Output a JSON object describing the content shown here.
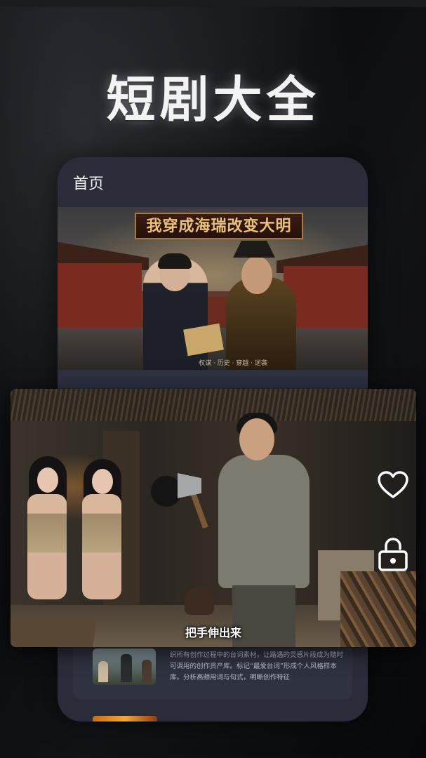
{
  "headline": "短剧大全",
  "phone": {
    "title": "首页",
    "poster": {
      "banner": "我穿成海瑞改变大明",
      "credits": "权谋 · 历史 · 穿越 · 逆袭"
    },
    "list_item": {
      "description": "织所有创作过程中的台词素材，让路遇的灵感片段成为随时可调用的创作资产库。标记“最爱台词”形成个人风格样本库。分析高频用词与句式，明晰创作特征"
    }
  },
  "video": {
    "subtitle": "把手伸出来"
  },
  "icons": {
    "like": "heart-icon",
    "lock": "unlock-icon"
  },
  "colors": {
    "phone_bg": "#2a2d39",
    "accent_white": "#ffffff"
  }
}
